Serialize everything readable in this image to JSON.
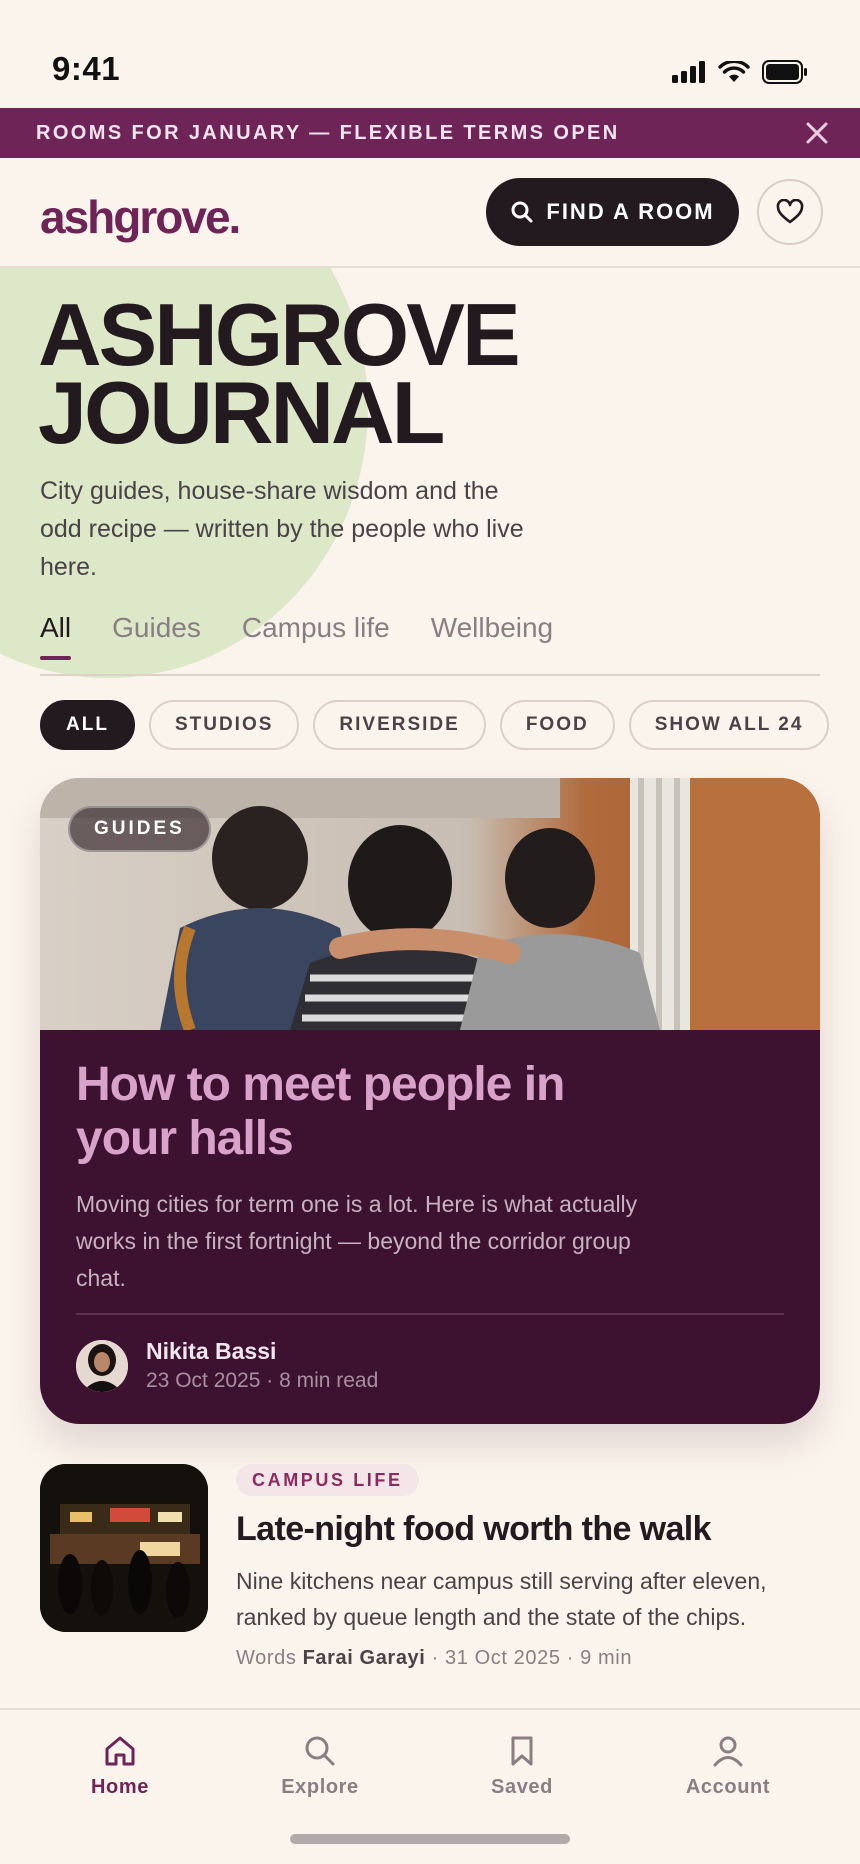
{
  "status": {
    "time": "9:41"
  },
  "banner": {
    "text": "ROOMS FOR JANUARY — FLEXIBLE TERMS OPEN"
  },
  "header": {
    "logo": "ashgrove.",
    "find_label": "FIND A ROOM"
  },
  "hero": {
    "title_line1": "ASHGROVE",
    "title_line2": "JOURNAL",
    "subtitle": "City guides, house-share wisdom and the odd recipe — written by the people who live here."
  },
  "tabs": [
    "All",
    "Guides",
    "Campus life",
    "Wellbeing"
  ],
  "chips": [
    "ALL",
    "STUDIOS",
    "RIVERSIDE",
    "FOOD",
    "SHOW ALL 24"
  ],
  "feature": {
    "badge": "GUIDES",
    "title": "How to meet people in your halls",
    "description": "Moving cities for term one is a lot. Here is what actually works in the first fortnight — beyond the corridor group chat.",
    "author_name": "Nikita Bassi",
    "author_meta": "23 Oct 2025 · 8 min read"
  },
  "article": {
    "tag": "CAMPUS LIFE",
    "title": "Late-night food worth the walk",
    "description": "Nine kitchens near campus still serving after eleven, ranked by queue length and the state of the chips.",
    "meta_prefix": "Words",
    "author": "Farai Garayi",
    "meta_suffix": "· 31 Oct 2025 · 9 min"
  },
  "nav": [
    "Home",
    "Explore",
    "Saved",
    "Account"
  ],
  "colors": {
    "brand": "#6e2456",
    "dark": "#231a20",
    "feature_bg": "#3d1231",
    "hero_blob": "#dde8c8",
    "page_bg": "#fbf4ec"
  }
}
